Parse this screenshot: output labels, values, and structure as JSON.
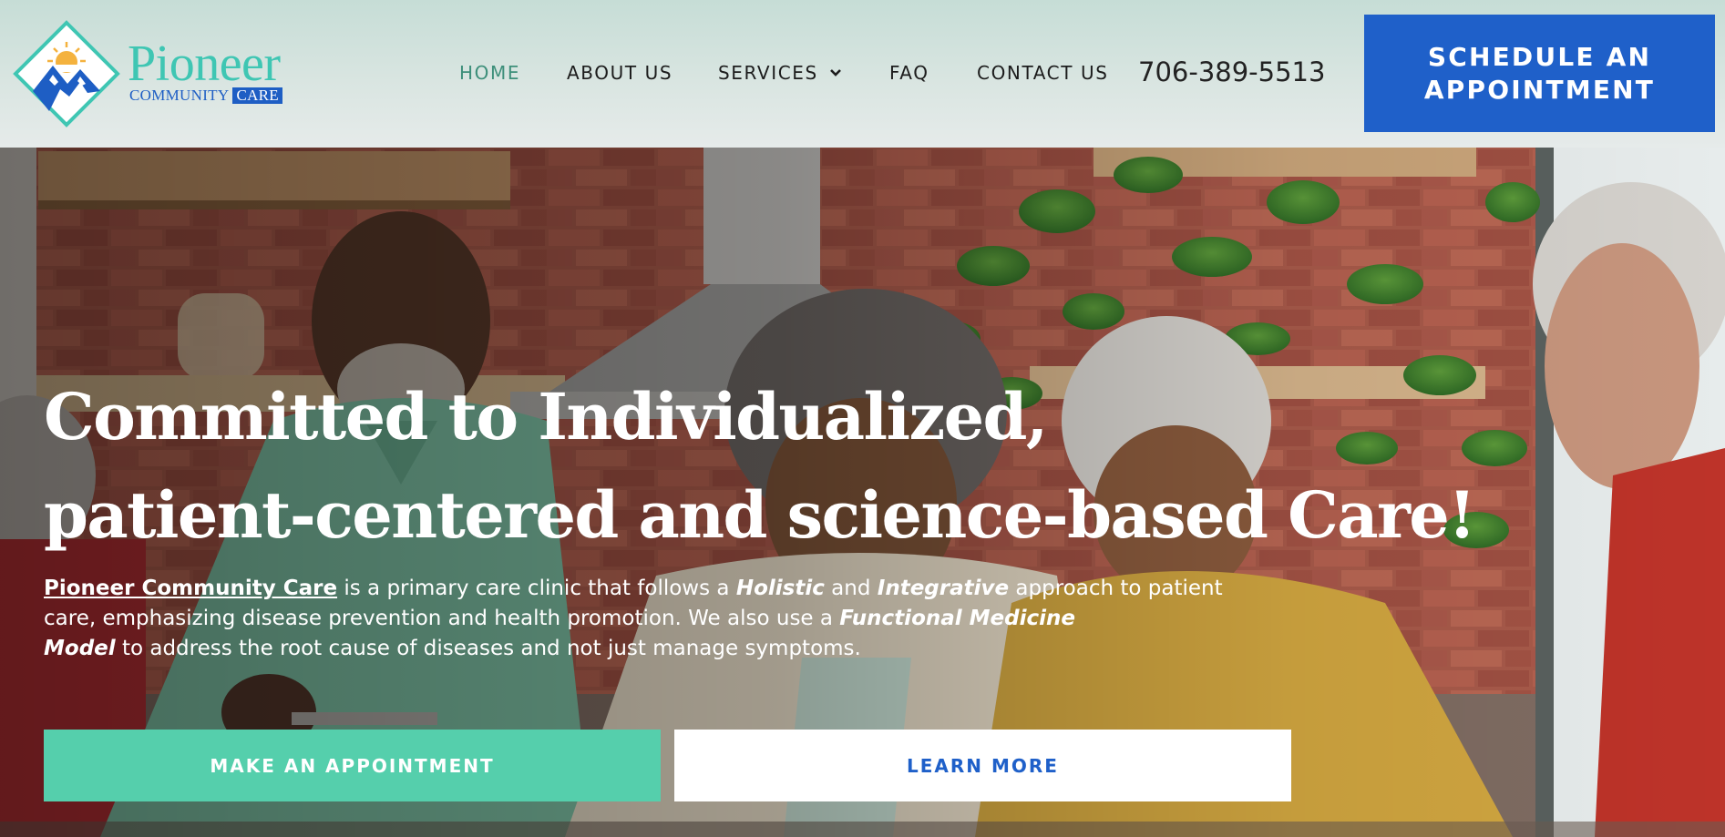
{
  "brand": {
    "name": "Pioneer",
    "tagline_prefix": "COMMUNITY",
    "tagline_badge": "CARE",
    "color_teal": "#3fc6b3",
    "color_blue": "#1e5ec4",
    "color_sun": "#f4b23e"
  },
  "nav": {
    "items": [
      {
        "label": "HOME",
        "active": true
      },
      {
        "label": "ABOUT US",
        "active": false
      },
      {
        "label": "SERVICES",
        "active": false,
        "has_dropdown": true
      },
      {
        "label": "FAQ",
        "active": false
      },
      {
        "label": "CONTACT US",
        "active": false
      }
    ],
    "active_color": "#3d8f7a"
  },
  "header": {
    "phone": "706-389-5513",
    "cta_label": "SCHEDULE AN APPOINTMENT",
    "cta_color": "#1f60c9"
  },
  "hero": {
    "title_line1": "Committed to Individualized,",
    "title_line2": "patient-centered and science-based Care!",
    "desc": {
      "link": "Pioneer Community Care",
      "t1": " is a primary care clinic that follows a ",
      "b1": "Holistic",
      "t2": " and ",
      "b2": "Integrative",
      "t3": " approach to patient",
      "t4": "care, emphasizing disease prevention and health promotion. We also use a ",
      "b3": "Functional Medicine",
      "b4": "Model",
      "t5": " to address the root cause of diseases and not just manage symptoms."
    },
    "primary_button": "MAKE AN APPOINTMENT",
    "secondary_button": "LEARN MORE",
    "primary_color": "#55cfac",
    "image_subject": "Four seniors laughing together around a kitchen table"
  }
}
